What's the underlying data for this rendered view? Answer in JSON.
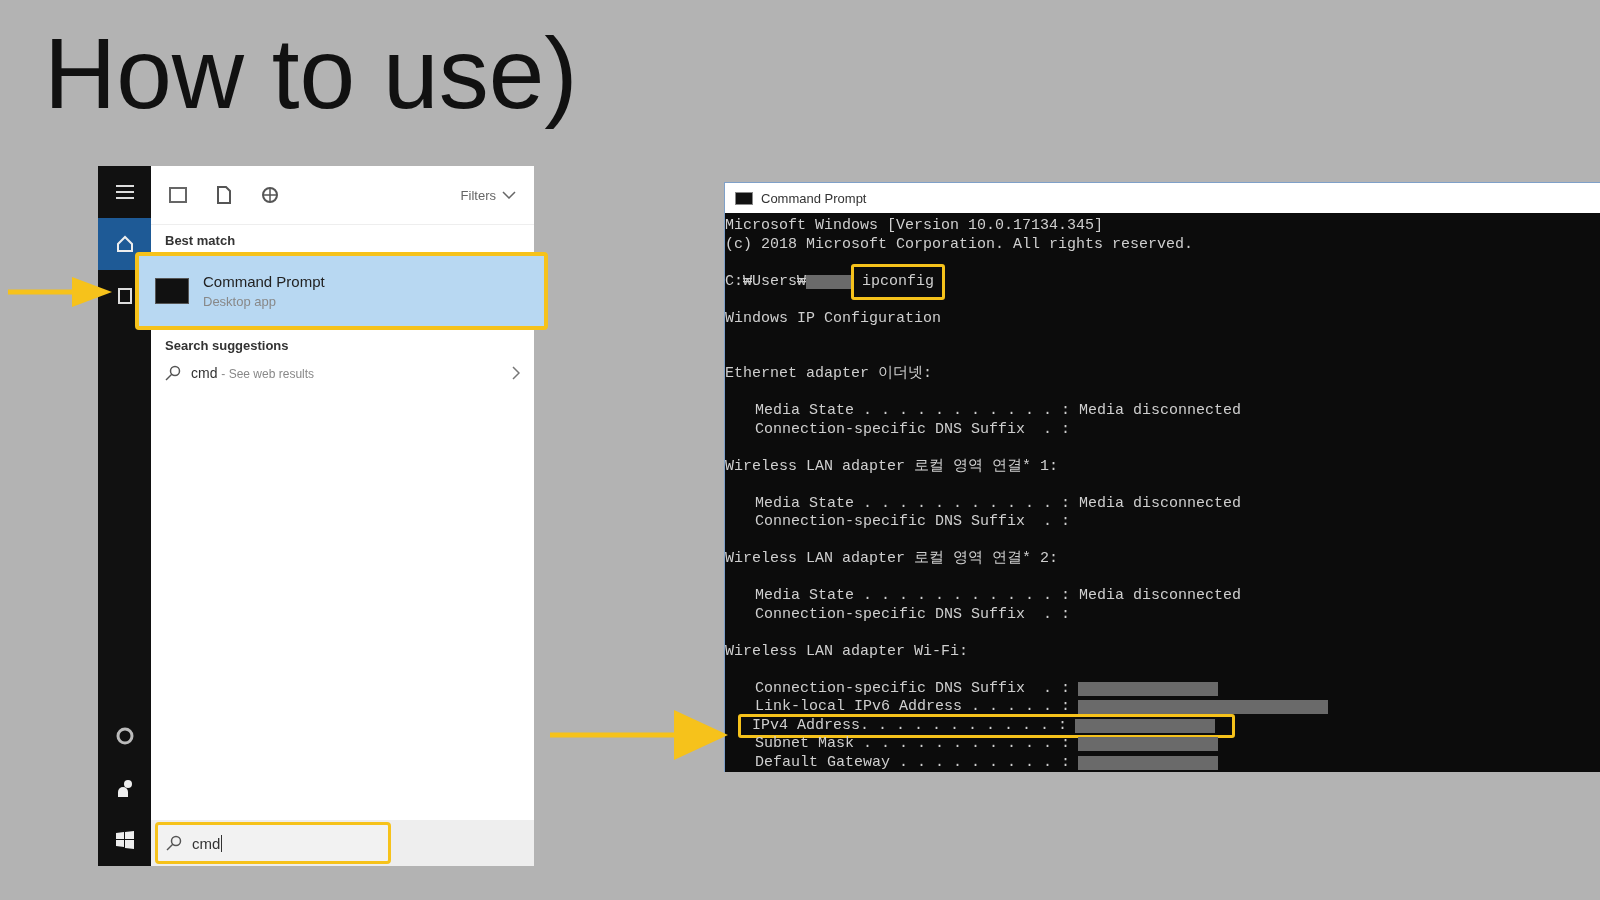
{
  "title": "How to use)",
  "start_menu": {
    "rail": [
      {
        "kind": "menu",
        "selected": false
      },
      {
        "kind": "home",
        "selected": true
      },
      {
        "kind": "document",
        "selected": false
      },
      {
        "kind": "settings",
        "selected": false
      },
      {
        "kind": "user",
        "selected": false
      },
      {
        "kind": "windows",
        "selected": false
      }
    ],
    "toolbar": {
      "filters_label": "Filters"
    },
    "best_match": {
      "heading": "Best match",
      "item": {
        "title": "Command Prompt",
        "subtitle": "Desktop app",
        "selected": true,
        "highlighted": true
      }
    },
    "suggestions": {
      "heading": "Search suggestions",
      "items": [
        {
          "query": "cmd",
          "hint": "- See web results"
        }
      ]
    },
    "search": {
      "value": "cmd",
      "highlighted": true
    }
  },
  "console": {
    "window": {
      "title": "Command Prompt"
    },
    "lines": [
      {
        "kind": "text",
        "text": "Microsoft Windows [Version 10.0.17134.345]"
      },
      {
        "kind": "text",
        "text": "(c) 2018 Microsoft Corporation. All rights reserved."
      },
      {
        "kind": "blank"
      },
      {
        "kind": "prompt",
        "path": "C:₩Users₩",
        "command": "ipconfig",
        "highlighted": true
      },
      {
        "kind": "blank"
      },
      {
        "kind": "text",
        "text": "Windows IP Configuration"
      },
      {
        "kind": "blank"
      },
      {
        "kind": "blank"
      },
      {
        "kind": "text",
        "text": "Ethernet adapter 이더넷:"
      },
      {
        "kind": "blank"
      },
      {
        "kind": "field",
        "label": "Media State . . . . . . . . . . . :",
        "value": "Media disconnected",
        "highlighted": false
      },
      {
        "kind": "field",
        "label": "Connection-specific DNS Suffix  . :",
        "highlighted": false
      },
      {
        "kind": "blank"
      },
      {
        "kind": "text",
        "text": "Wireless LAN adapter 로컬 영역 연결* 1:"
      },
      {
        "kind": "blank"
      },
      {
        "kind": "field",
        "label": "Media State . . . . . . . . . . . :",
        "value": "Media disconnected",
        "highlighted": false
      },
      {
        "kind": "field",
        "label": "Connection-specific DNS Suffix  . :",
        "highlighted": false
      },
      {
        "kind": "blank"
      },
      {
        "kind": "text",
        "text": "Wireless LAN adapter 로컬 영역 연결* 2:"
      },
      {
        "kind": "blank"
      },
      {
        "kind": "field",
        "label": "Media State . . . . . . . . . . . :",
        "value": "Media disconnected",
        "highlighted": false
      },
      {
        "kind": "field",
        "label": "Connection-specific DNS Suffix  . :",
        "highlighted": false
      },
      {
        "kind": "blank"
      },
      {
        "kind": "text",
        "text": "Wireless LAN adapter Wi-Fi:"
      },
      {
        "kind": "blank"
      },
      {
        "kind": "redacted",
        "label": "Connection-specific DNS Suffix  . :",
        "highlighted": false
      },
      {
        "kind": "redacted_wide",
        "label": "Link-local IPv6 Address . . . . . :",
        "highlighted": false
      },
      {
        "kind": "redacted",
        "label": "IPv4 Address. . . . . . . . . . . :",
        "highlighted": true
      },
      {
        "kind": "redacted",
        "label": "Subnet Mask . . . . . . . . . . . :",
        "highlighted": false
      },
      {
        "kind": "redacted",
        "label": "Default Gateway . . . . . . . . . :",
        "highlighted": false
      }
    ]
  }
}
